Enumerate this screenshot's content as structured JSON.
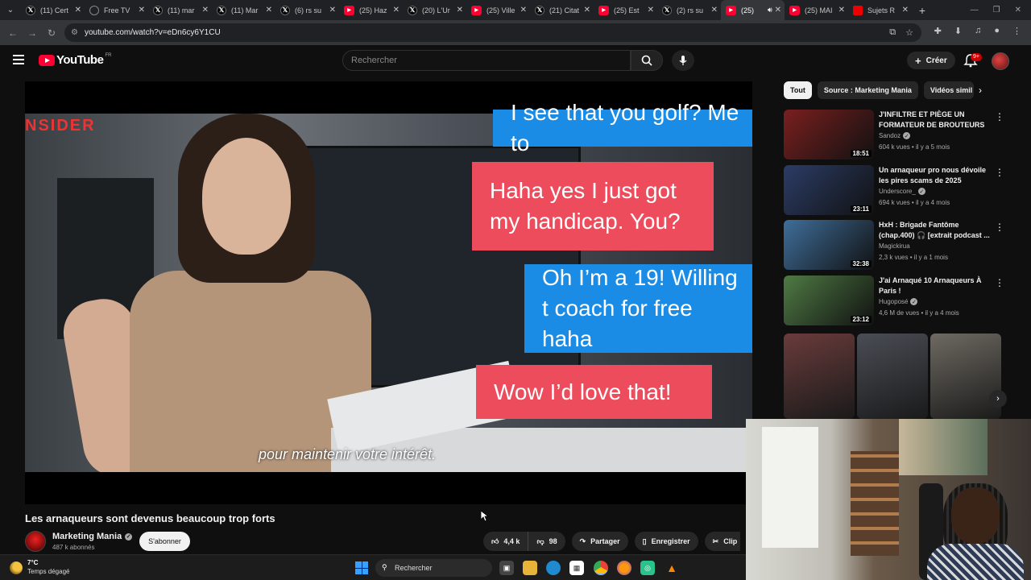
{
  "browser": {
    "tabs": [
      {
        "label": "(11) Cert",
        "icon": "x-logo-icon"
      },
      {
        "label": "Free TV",
        "icon": "tv-icon"
      },
      {
        "label": "(11) mar",
        "icon": "x-logo-icon"
      },
      {
        "label": "(11) Mar",
        "icon": "x-logo-icon"
      },
      {
        "label": "(6) rs su",
        "icon": "x-logo-icon"
      },
      {
        "label": "(25) Haz",
        "icon": "youtube-icon"
      },
      {
        "label": "(20) L'Ur",
        "icon": "x-logo-icon"
      },
      {
        "label": "(25) Ville",
        "icon": "youtube-icon"
      },
      {
        "label": "(21) Citat",
        "icon": "x-logo-icon"
      },
      {
        "label": "(25) Est",
        "icon": "youtube-icon"
      },
      {
        "label": "(2) rs su",
        "icon": "x-logo-icon"
      },
      {
        "label": "(25)",
        "icon": "youtube-icon"
      },
      {
        "label": "(25) MAI",
        "icon": "youtube-icon"
      },
      {
        "label": "Sujets R",
        "icon": "red-square-icon"
      }
    ],
    "active_tab_index": 11,
    "url": "youtube.com/watch?v=eDn6cy6Y1CU"
  },
  "youtube": {
    "logo_text": "YouTube",
    "region": "FR",
    "search_placeholder": "Rechercher",
    "create_label": "Créer",
    "notification_count": "9+"
  },
  "video": {
    "bubbles": [
      {
        "text": "I see that you golf? Me to",
        "color": "#1a8ce6"
      },
      {
        "text": "Haha yes I just got my handicap. You?",
        "color": "#ed4c5c"
      },
      {
        "text": "Oh I’m a 19! Willing t coach for free haha",
        "color": "#1a8ce6"
      },
      {
        "text": "Wow I’d love that!",
        "color": "#ed4c5c"
      }
    ],
    "watermark": "NSIDER",
    "subtitle": "pour maintenir votre intérêt.",
    "title": "Les arnaqueurs sont devenus beaucoup trop forts",
    "channel_name": "Marketing Mania",
    "subscribers": "487 k abonnés",
    "subscribe_label": "S'abonner",
    "likes": "4,4 k",
    "dislikes": "98",
    "share_label": "Partager",
    "save_label": "Enregistrer",
    "clip_label": "Clip"
  },
  "sidebar": {
    "chips": [
      "Tout",
      "Source : Marketing Mania",
      "Vidéos simil"
    ],
    "recommendations": [
      {
        "title": "J'INFILTRE ET PIÈGE UN FORMATEUR DE BROUTEURS",
        "channel": "Sandoz",
        "views": "604 k vues",
        "age": "il y a 5 mois",
        "duration": "18:51",
        "verified": true,
        "thumb_color": "#7a1f1f"
      },
      {
        "title": "Un arnaqueur pro nous dévoile les pires scams de 2025",
        "channel": "Underscore_",
        "views": "694 k vues",
        "age": "il y a 4 mois",
        "duration": "23:11",
        "verified": true,
        "thumb_color": "#2b3c66"
      },
      {
        "title": "HxH : Brigade Fantôme (chap.400) 🎧 [extrait podcast ...",
        "channel": "Magickirua",
        "views": "2,3 k vues",
        "age": "il y a 1 mois",
        "duration": "32:38",
        "verified": false,
        "thumb_color": "#3f6e9a"
      },
      {
        "title": "J'ai Arnaqué 10 Arnaqueurs À Paris !",
        "channel": "Hugoposé",
        "views": "4,6 M de vues",
        "age": "il y a 4 mois",
        "duration": "23:12",
        "verified": true,
        "thumb_color": "#4f7a44"
      }
    ],
    "shorts_colors": [
      "#6a3b3b",
      "#4a4d55",
      "#6e6a62"
    ]
  },
  "taskbar": {
    "temperature": "7°C",
    "weather": "Temps dégagé",
    "search_label": "Rechercher"
  }
}
